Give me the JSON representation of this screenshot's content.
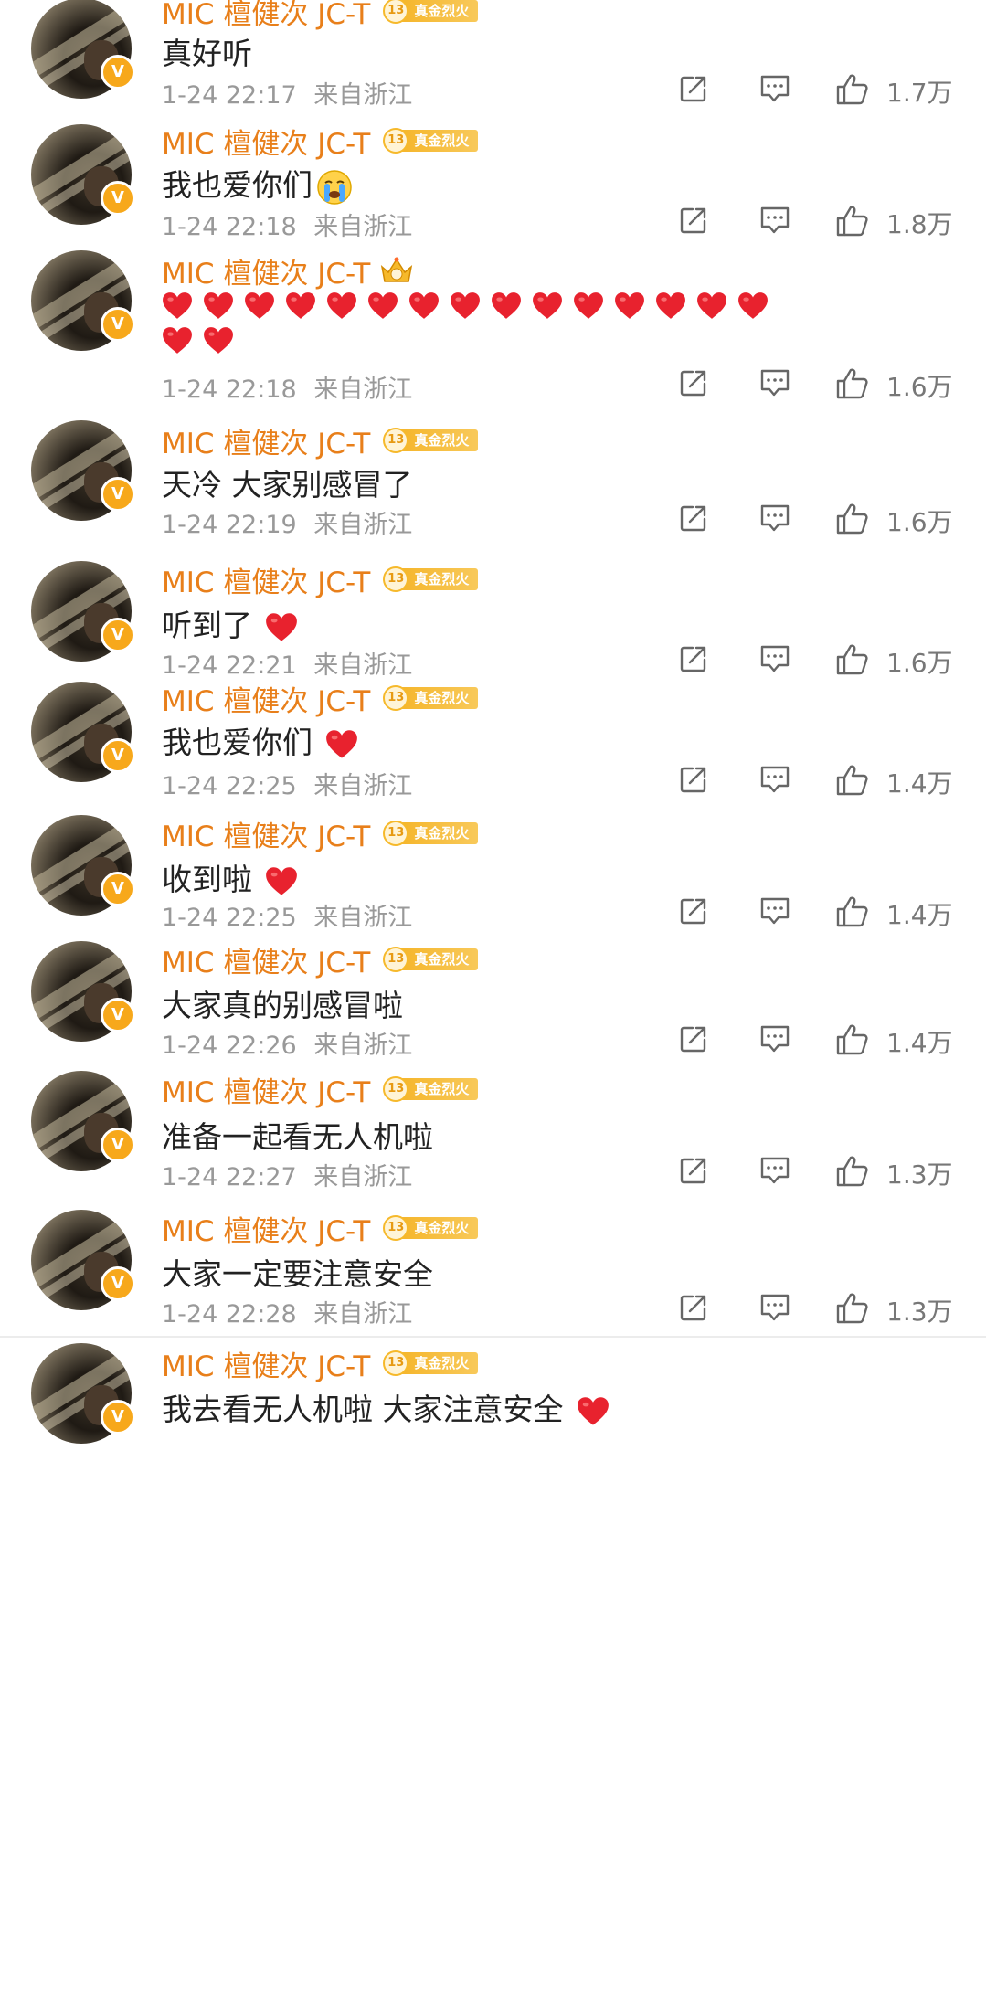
{
  "comments": [
    {
      "username": "MIC 檀健次 JC-T",
      "badge_level": "13",
      "badge_label": "真金烈火",
      "badge_kind": "fan",
      "text": "真好听",
      "trailing_emoji": "",
      "time": "1-24 22:17",
      "location": "来自浙江",
      "likes": "1.7万"
    },
    {
      "username": "MIC 檀健次 JC-T",
      "badge_level": "13",
      "badge_label": "真金烈火",
      "badge_kind": "fan",
      "text": "我也爱你们",
      "trailing_emoji": "crying-face-emoji",
      "time": "1-24 22:18",
      "location": "来自浙江",
      "likes": "1.8万"
    },
    {
      "username": "MIC 檀健次 JC-T",
      "badge_level": "",
      "badge_label": "",
      "badge_kind": "crown",
      "text": "",
      "heart_count": 17,
      "time": "1-24 22:18",
      "location": "来自浙江",
      "likes": "1.6万"
    },
    {
      "username": "MIC 檀健次 JC-T",
      "badge_level": "13",
      "badge_label": "真金烈火",
      "badge_kind": "fan",
      "text": "天冷 大家别感冒了",
      "trailing_emoji": "",
      "time": "1-24 22:19",
      "location": "来自浙江",
      "likes": "1.6万"
    },
    {
      "username": "MIC 檀健次 JC-T",
      "badge_level": "13",
      "badge_label": "真金烈火",
      "badge_kind": "fan",
      "text": "听到了",
      "trailing_emoji": "heart",
      "time": "1-24 22:21",
      "location": "来自浙江",
      "likes": "1.6万"
    },
    {
      "username": "MIC 檀健次 JC-T",
      "badge_level": "13",
      "badge_label": "真金烈火",
      "badge_kind": "fan",
      "text": "我也爱你们",
      "trailing_emoji": "heart",
      "time": "1-24 22:25",
      "location": "来自浙江",
      "likes": "1.4万"
    },
    {
      "username": "MIC 檀健次 JC-T",
      "badge_level": "13",
      "badge_label": "真金烈火",
      "badge_kind": "fan",
      "text": "收到啦",
      "trailing_emoji": "heart",
      "time": "1-24 22:25",
      "location": "来自浙江",
      "likes": "1.4万"
    },
    {
      "username": "MIC 檀健次 JC-T",
      "badge_level": "13",
      "badge_label": "真金烈火",
      "badge_kind": "fan",
      "text": "大家真的别感冒啦",
      "trailing_emoji": "",
      "time": "1-24 22:26",
      "location": "来自浙江",
      "likes": "1.4万"
    },
    {
      "username": "MIC 檀健次 JC-T",
      "badge_level": "13",
      "badge_label": "真金烈火",
      "badge_kind": "fan",
      "text": "准备一起看无人机啦",
      "trailing_emoji": "",
      "time": "1-24 22:27",
      "location": "来自浙江",
      "likes": "1.3万"
    },
    {
      "username": "MIC 檀健次 JC-T",
      "badge_level": "13",
      "badge_label": "真金烈火",
      "badge_kind": "fan",
      "text": "大家一定要注意安全",
      "trailing_emoji": "",
      "time": "1-24 22:28",
      "location": "来自浙江",
      "likes": "1.3万"
    },
    {
      "username": "MIC 檀健次 JC-T",
      "badge_level": "13",
      "badge_label": "真金烈火",
      "badge_kind": "fan",
      "text": "我去看无人机啦 大家注意安全",
      "trailing_emoji": "heart",
      "time": "",
      "location": "",
      "likes": ""
    }
  ],
  "icons": {
    "share": "share-icon",
    "comment": "comment-icon",
    "like": "thumbs-up-icon",
    "verified": "verified-v-icon"
  },
  "colors": {
    "username": "#e87f1a",
    "heart": "#e8222e",
    "meta_text": "#999999",
    "badge_gold": "#f6b92b"
  }
}
